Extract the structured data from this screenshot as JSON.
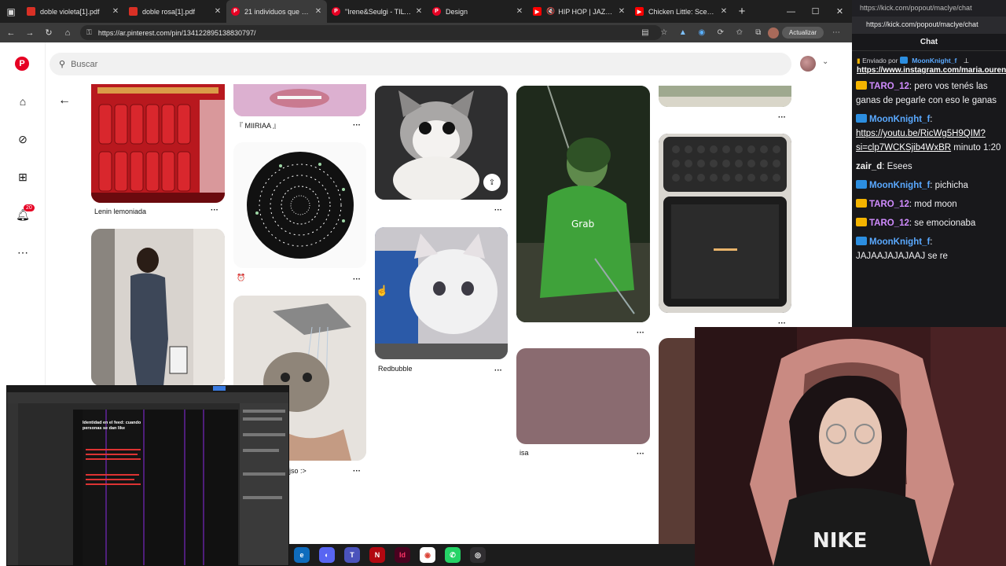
{
  "browser": {
    "tabs": [
      {
        "title": "doble violeta[1].pdf",
        "fav_color": "#d93025"
      },
      {
        "title": "doble rosa[1].pdf",
        "fav_color": "#d93025"
      },
      {
        "title": "21 individuos que empe",
        "fav_color": "#e60023"
      },
      {
        "title": "\"Irene&Seulgi - TILT\" Ma",
        "fav_color": "#e60023"
      },
      {
        "title": "Design",
        "fav_color": "#e60023"
      },
      {
        "title": "HIP HOP | JAZZ BO",
        "fav_color": "#ff0000"
      },
      {
        "title": "Chicken Little: Scenes Pl",
        "fav_color": "#ff0000"
      }
    ],
    "url": "https://ar.pinterest.com/pin/134122895138830797/",
    "update_label": "Actualizar"
  },
  "pinterest": {
    "search_placeholder": "Buscar",
    "notification_count": "20",
    "pins": {
      "lenin": "Lenin lemoniada",
      "miiriaa": "『 MIIRIAA 』",
      "clock_emoji": "⏰",
      "redbubble": "Redbubble",
      "isa": "isa",
      "bath": "jso :>"
    }
  },
  "chat": {
    "popout_url": "https://kick.com/popout/maclye/chat",
    "title": "Chat",
    "pinned": {
      "sent_by": "Enviado por",
      "user": "MoonKnight_f",
      "link": "https://www.instagram.com/maria.ourens?..."
    },
    "messages": [
      {
        "user": "TARO_12",
        "color": "#d18cff",
        "badge": "#f4b400",
        "text": ": pero vos tenés las ganas de pegarle con eso le ganas",
        "link": ""
      },
      {
        "user": "MoonKnight_f",
        "color": "#5aa9ff",
        "badge": "#2c8ee0",
        "text": ":",
        "link": "https://youtu.be/RicWg5H9QIM?si=clp7WCKSjib4WxBR",
        "tail": " minuto 1:20"
      },
      {
        "user": "zair_d",
        "color": "#f2f2f2",
        "badge": "",
        "text": ": Esees",
        "link": ""
      },
      {
        "user": "MoonKnight_f",
        "color": "#5aa9ff",
        "badge": "#2c8ee0",
        "text": ": pichicha",
        "link": ""
      },
      {
        "user": "TARO_12",
        "color": "#d18cff",
        "badge": "#f4b400",
        "text": ": mod moon",
        "link": ""
      },
      {
        "user": "TARO_12",
        "color": "#d18cff",
        "badge": "#f4b400",
        "text": ": se emocionaba",
        "link": ""
      },
      {
        "user": "MoonKnight_f",
        "color": "#5aa9ff",
        "badge": "#2c8ee0",
        "text": ": JAJAAJAJAJAAJ se re",
        "link": ""
      }
    ]
  },
  "design_overlay": {
    "doc_title": "Identidad en el feed: cuando personas se dan like"
  },
  "taskbar": {
    "apps": [
      "edge",
      "discord",
      "teams",
      "netflix",
      "indesign",
      "chrome",
      "whatsapp",
      "obs"
    ]
  }
}
